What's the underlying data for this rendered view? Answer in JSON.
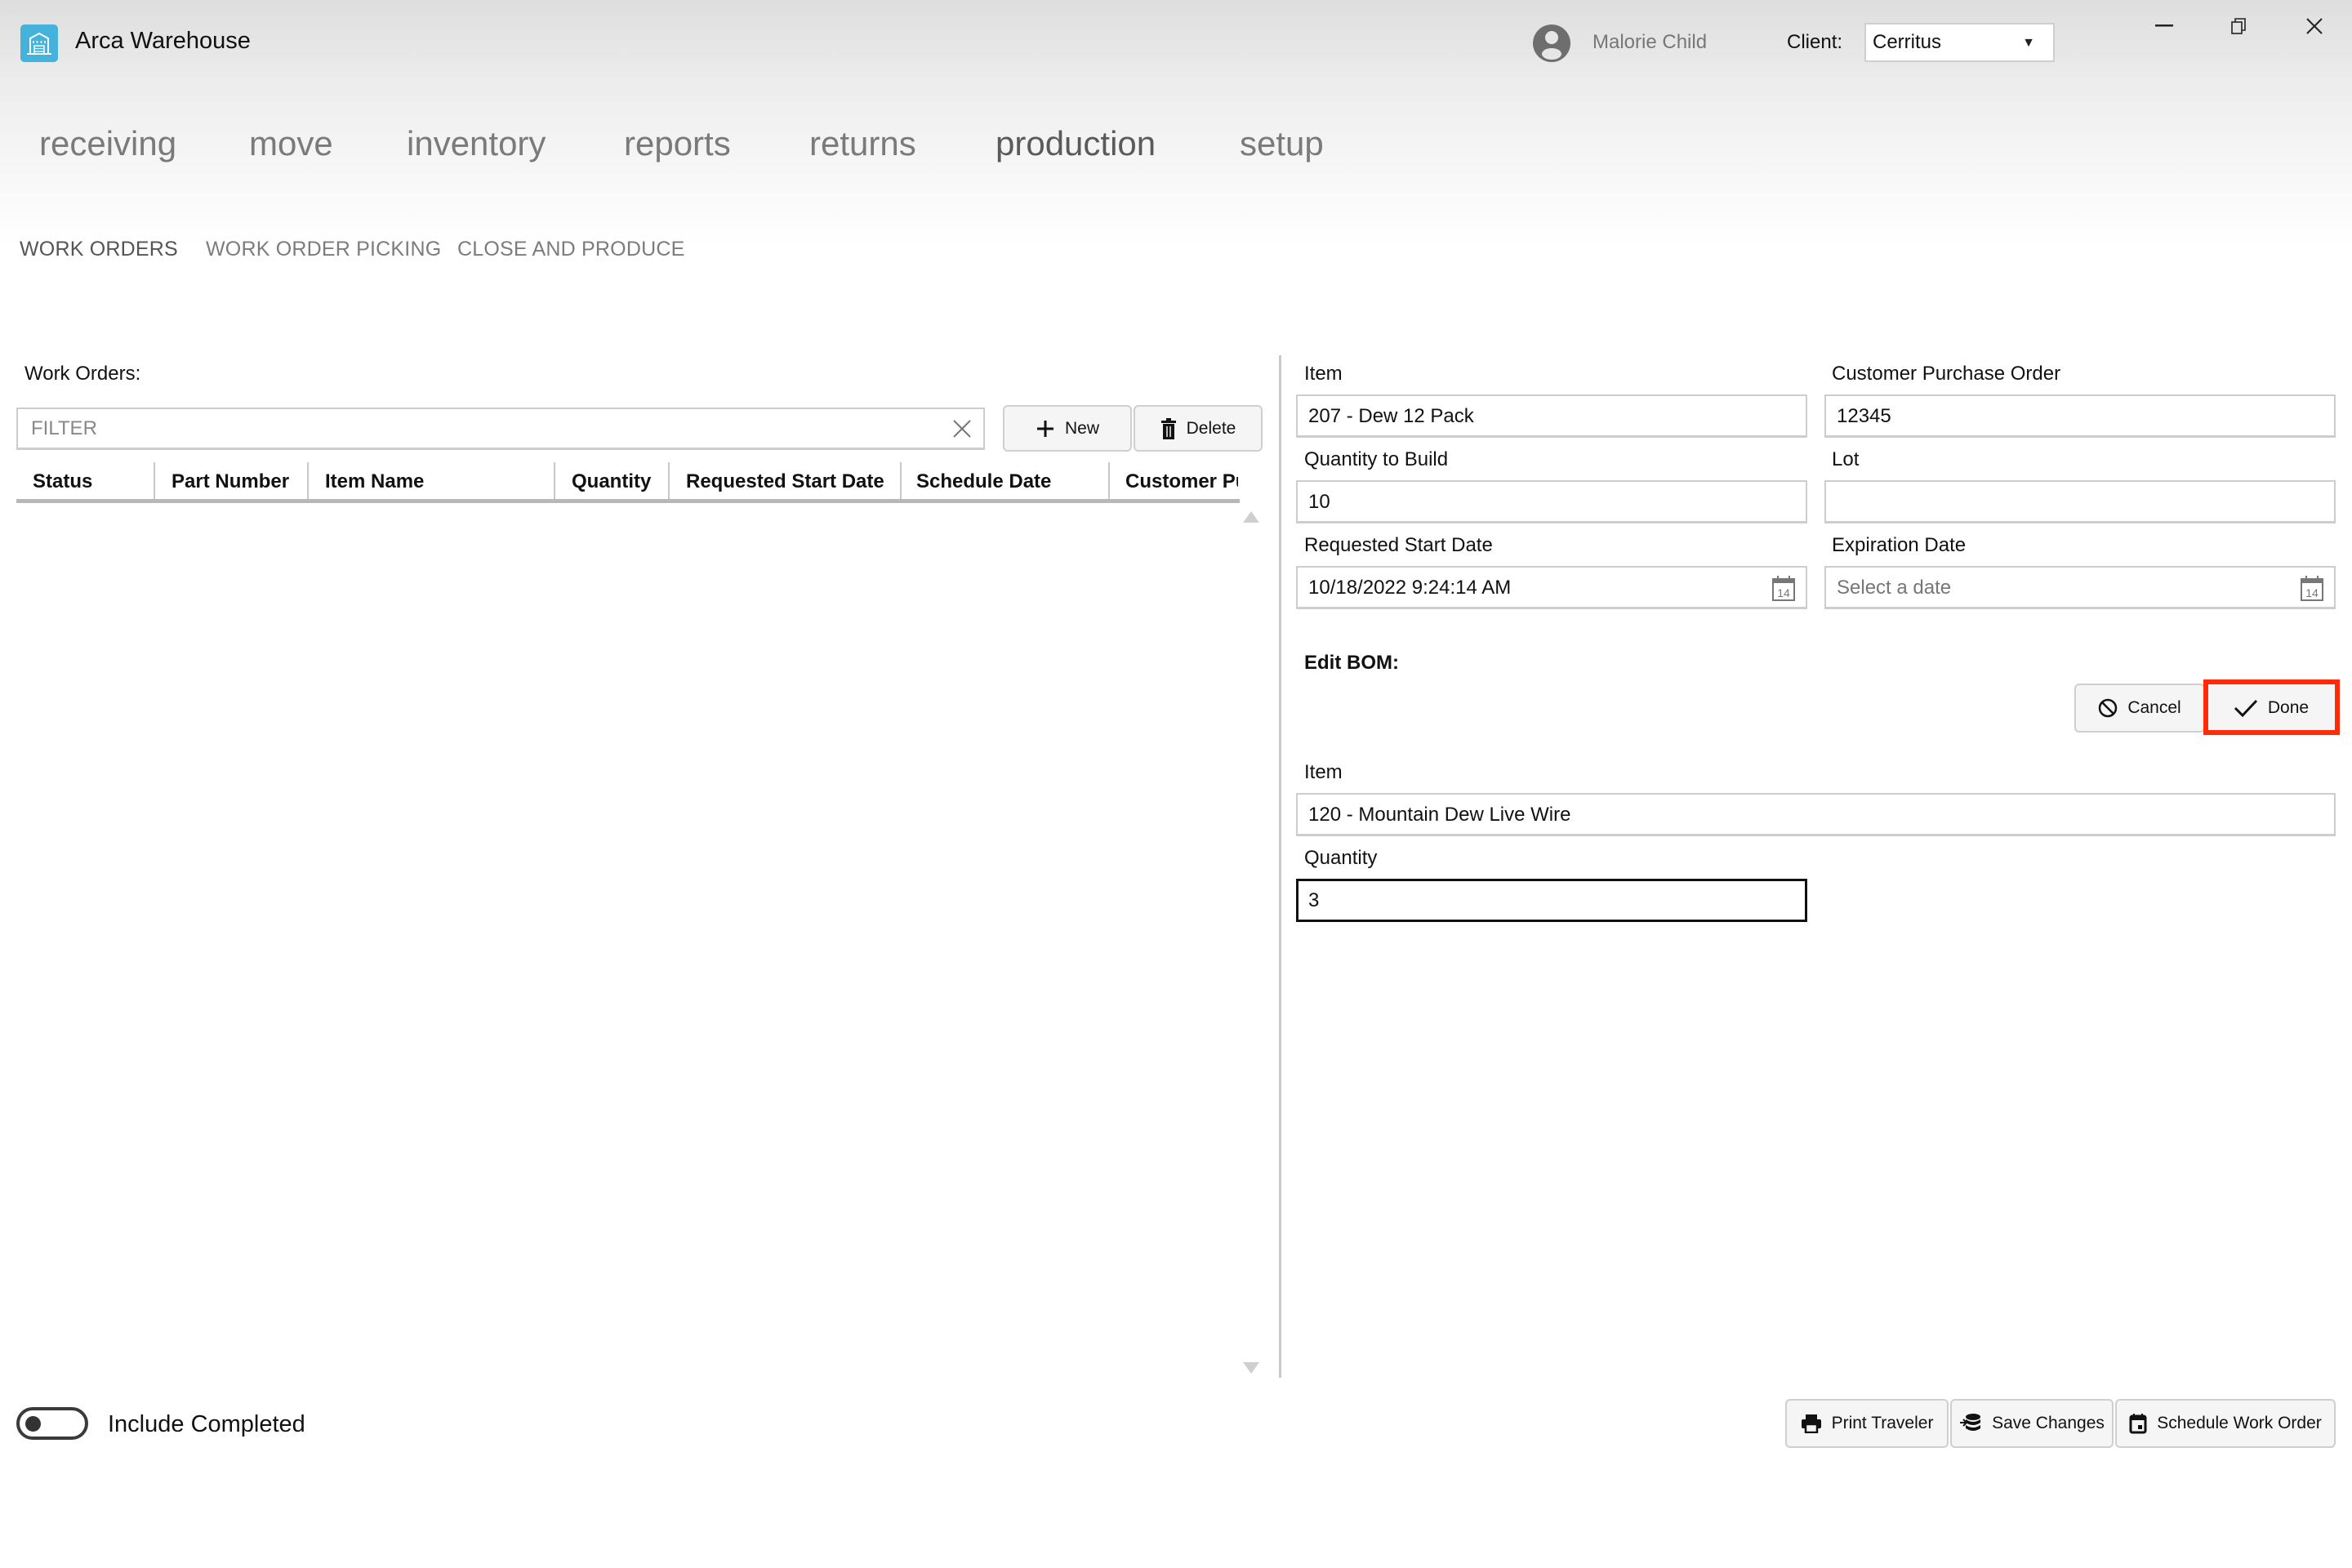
{
  "app": {
    "title": "Arca Warehouse",
    "logo_icon": "warehouse-icon",
    "brand_color": "#44b2da"
  },
  "user": {
    "name": "Malorie Child",
    "icon": "user-avatar-icon"
  },
  "client": {
    "label": "Client:",
    "selected": "Cerritus"
  },
  "window_controls": {
    "minimize": "–",
    "restore": "⧉",
    "close": "X"
  },
  "main_nav": {
    "items": [
      {
        "label": "receiving",
        "active": false
      },
      {
        "label": "move",
        "active": false
      },
      {
        "label": "inventory",
        "active": false
      },
      {
        "label": "reports",
        "active": false
      },
      {
        "label": "returns",
        "active": false
      },
      {
        "label": "production",
        "active": true
      },
      {
        "label": "setup",
        "active": false
      }
    ]
  },
  "sub_nav": {
    "items": [
      {
        "label": "WORK ORDERS",
        "active": true
      },
      {
        "label": "WORK ORDER PICKING",
        "active": false
      },
      {
        "label": "CLOSE AND PRODUCE",
        "active": false
      }
    ]
  },
  "work_orders": {
    "title": "Work Orders:",
    "filter_placeholder": "FILTER",
    "filter_value": "",
    "new_label": "New",
    "delete_label": "Delete",
    "columns": [
      "Status",
      "Part Number",
      "Item Name",
      "Quantity",
      "Requested Start Date",
      "Schedule Date",
      "Customer Pu"
    ],
    "rows": [],
    "include_completed_label": "Include Completed",
    "include_completed": false
  },
  "detail": {
    "item_label": "Item",
    "item_value": "207 - Dew 12 Pack",
    "cpo_label": "Customer Purchase Order",
    "cpo_value": "12345",
    "qty_build_label": "Quantity to Build",
    "qty_build_value": "10",
    "lot_label": "Lot",
    "lot_value": "",
    "req_start_label": "Requested Start Date",
    "req_start_value": "10/18/2022 9:24:14 AM",
    "exp_label": "Expiration Date",
    "exp_placeholder": "Select a date",
    "calendar_day": "14"
  },
  "bom": {
    "title": "Edit BOM:",
    "cancel_label": "Cancel",
    "done_label": "Done",
    "highlight_color": "#ff2a0a",
    "item_label": "Item",
    "item_value": "120 - Mountain Dew Live Wire",
    "quantity_label": "Quantity",
    "quantity_value": "3"
  },
  "footer": {
    "print_label": "Print Traveler",
    "save_label": "Save Changes",
    "schedule_label": "Schedule Work Order"
  }
}
